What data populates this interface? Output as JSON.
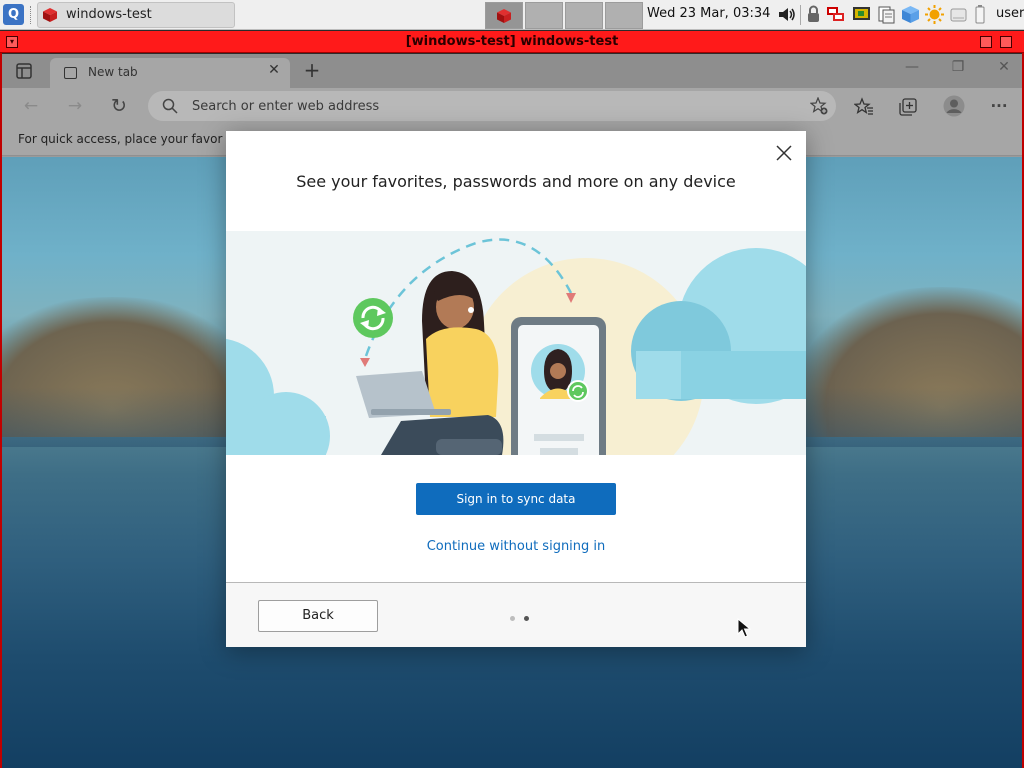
{
  "taskbar": {
    "start_glyph": "Q",
    "task_label": "windows-test",
    "clock": "Wed 23 Mar, 03:34",
    "user": "user"
  },
  "window": {
    "title": "[windows-test] windows-test"
  },
  "browser": {
    "tab_label": "New tab",
    "tab_close": "✕",
    "new_tab": "+",
    "controls": {
      "minimize": "—",
      "restore": "❐",
      "close": "✕"
    },
    "nav": {
      "back": "←",
      "forward": "→",
      "refresh": "↻",
      "more": "···"
    },
    "address_placeholder": "Search or enter web address",
    "favorites_bar_text": "For quick access, place your favorites here on the favorites bar."
  },
  "dialog": {
    "close_label": "✕",
    "title": "See your favorites, passwords and more on any device",
    "primary_button": "Sign in to sync data",
    "secondary_link": "Continue without signing in",
    "back_button": "Back",
    "pager": {
      "total": 2,
      "current": 2
    }
  },
  "colors": {
    "accent": "#0f6cbd",
    "window_title_bar": "#ff1a1a",
    "dialog_background": "#ffffff"
  }
}
